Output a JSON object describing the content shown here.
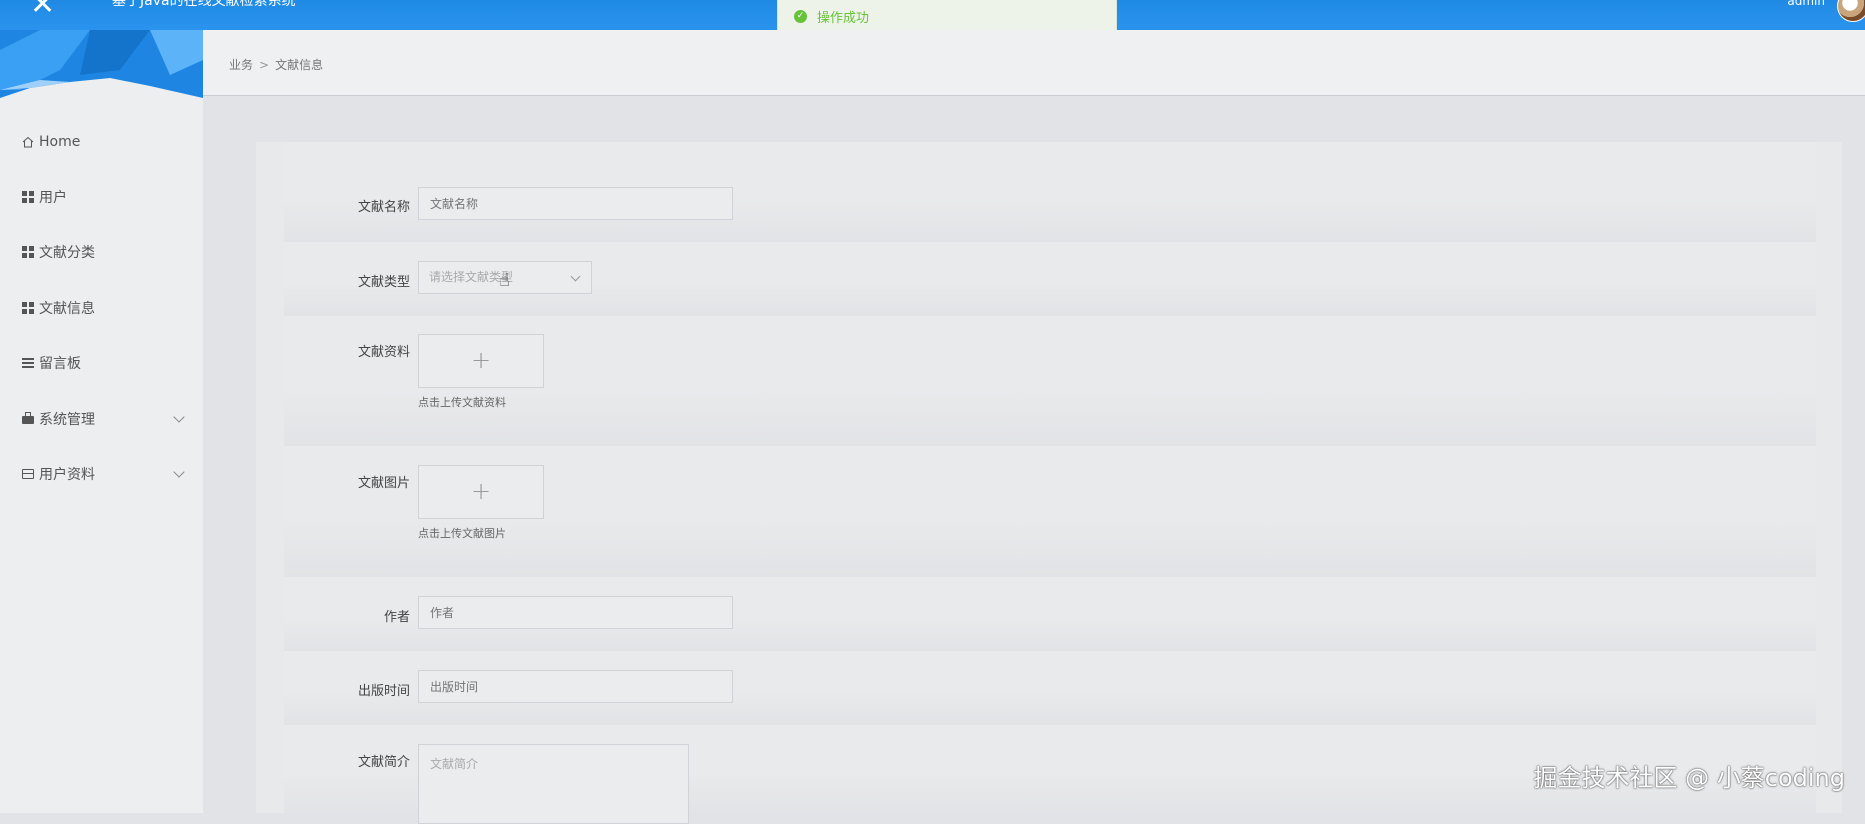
{
  "header": {
    "title": "基于Java的在线文献检索系统",
    "user_name": "admin"
  },
  "toast": {
    "message": "操作成功"
  },
  "sidebar": {
    "items": [
      {
        "label": "Home",
        "icon": "home-icon"
      },
      {
        "label": "用户",
        "icon": "grid-icon"
      },
      {
        "label": "文献分类",
        "icon": "grid-icon"
      },
      {
        "label": "文献信息",
        "icon": "grid-icon"
      },
      {
        "label": "留言板",
        "icon": "list-icon"
      },
      {
        "label": "系统管理",
        "icon": "briefcase-icon",
        "expandable": true
      },
      {
        "label": "用户资料",
        "icon": "card-icon",
        "expandable": true
      }
    ]
  },
  "breadcrumb": {
    "parent": "业务",
    "separator": ">",
    "current": "文献信息"
  },
  "form": {
    "name": {
      "label": "文献名称",
      "placeholder": "文献名称"
    },
    "type": {
      "label": "文献类型",
      "placeholder": "请选择文献类型"
    },
    "file": {
      "label": "文献资料",
      "tip": "点击上传文献资料",
      "plus": "+"
    },
    "image": {
      "label": "文献图片",
      "tip": "点击上传文献图片",
      "plus": "+"
    },
    "author": {
      "label": "作者",
      "placeholder": "作者"
    },
    "publish_time": {
      "label": "出版时间",
      "placeholder": "出版时间"
    },
    "intro": {
      "label": "文献简介",
      "placeholder": "文献简介"
    }
  },
  "watermark": "掘金技术社区 @ 小蔡coding",
  "colors": {
    "topbar": "#2a93ee",
    "success": "#67c23a",
    "sidebar_bg": "#eceef0",
    "content_bg": "#e1e3e6"
  }
}
